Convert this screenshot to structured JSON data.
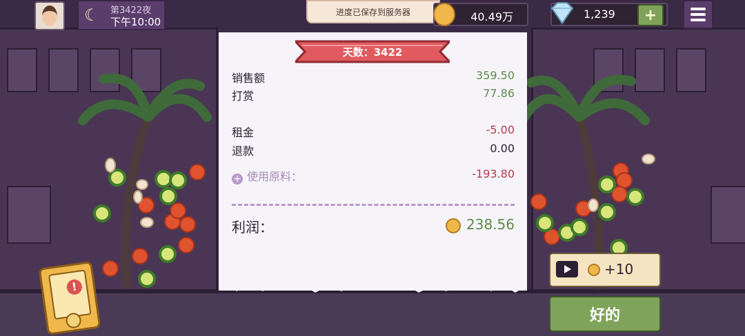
{
  "hud": {
    "day_label": "第3422夜",
    "time_label": "下午10:00",
    "toast": "进度已保存到服务器",
    "coins": "40.49万",
    "gems": "1,239",
    "add_symbol": "+"
  },
  "receipt": {
    "banner": "天数：3422",
    "rows": [
      {
        "label": "销售额",
        "value": "359.50"
      },
      {
        "label": "打赏",
        "value": "77.86"
      },
      {
        "label": "租金",
        "value": "-5.00"
      },
      {
        "label": "退款",
        "value": "0.00"
      },
      {
        "label": "使用原料：",
        "value": "-193.80"
      }
    ],
    "expand_symbol": "+",
    "profit_label": "利润：",
    "profit_value": "238.56"
  },
  "buttons": {
    "ad_reward": "+10",
    "ok": "好的"
  },
  "colors": {
    "positive": "#5c8a4a",
    "negative": "#b23a4d",
    "banner": "#e05a5f",
    "accent_green": "#7fa35a"
  },
  "icons": [
    "avatar",
    "moon-icon",
    "coin-icon",
    "diamond-icon",
    "plus-icon",
    "menu-icon",
    "play-icon",
    "alert-icon"
  ]
}
